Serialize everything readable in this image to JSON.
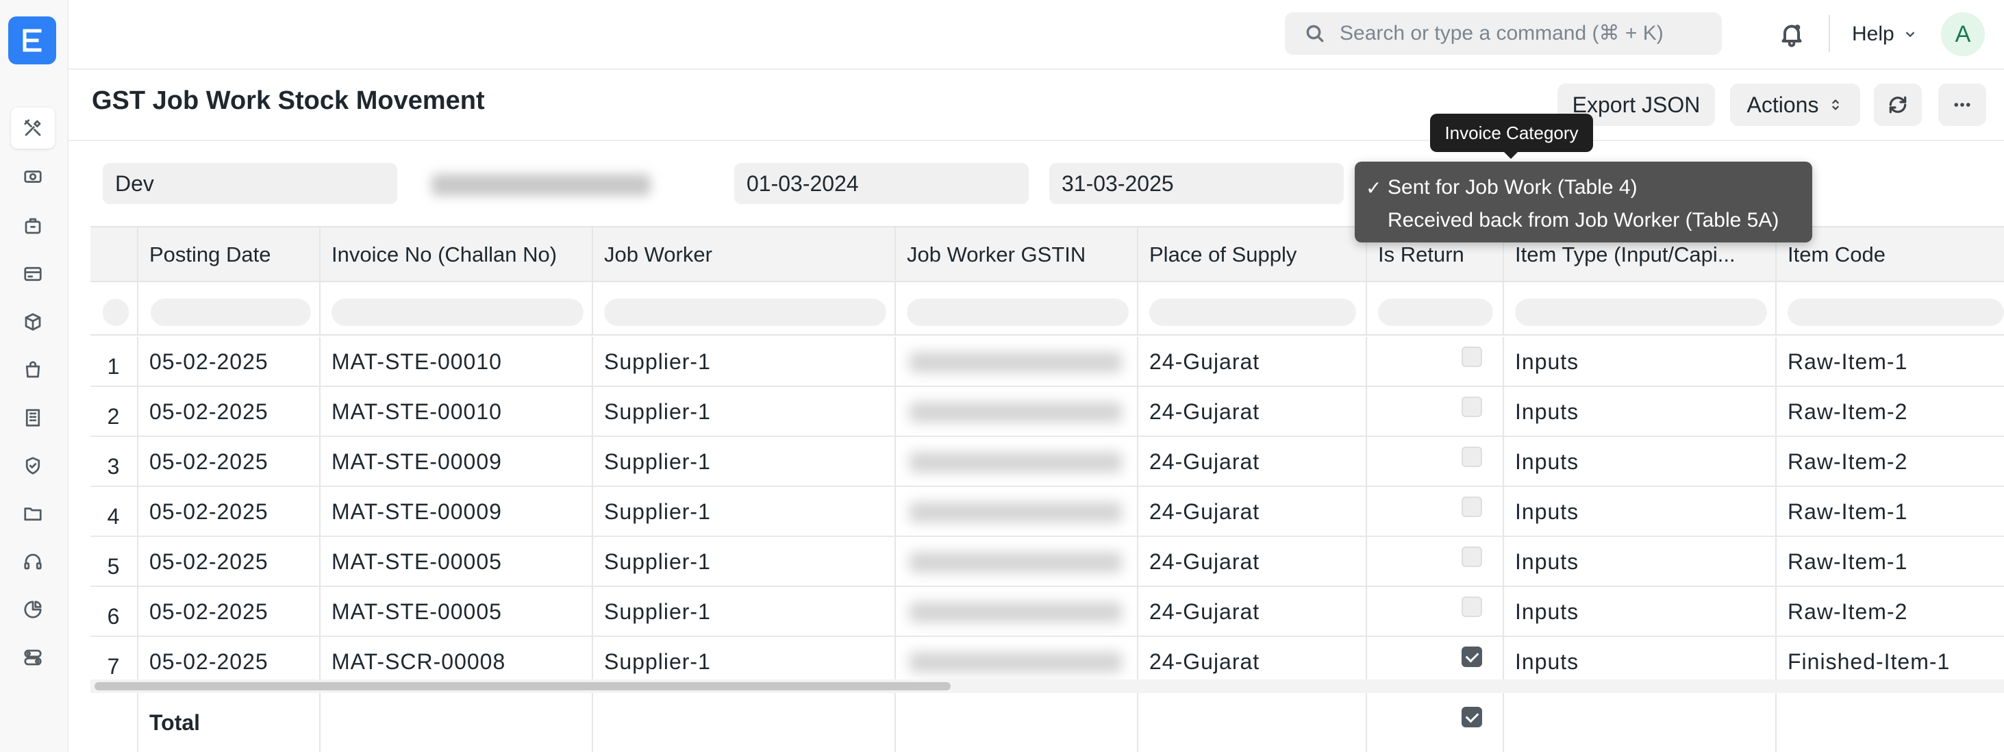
{
  "sidebar": {
    "logo_letter": "E",
    "icons": [
      "tools-icon",
      "money-icon",
      "briefcase-icon",
      "card-icon",
      "box-icon",
      "shopping-bag-icon",
      "building-icon",
      "shield-icon",
      "folder-icon",
      "headset-icon",
      "pie-chart-icon",
      "toggles-icon"
    ]
  },
  "navbar": {
    "search_placeholder": "Search or type a command (⌘ + K)",
    "help_label": "Help",
    "avatar_letter": "A"
  },
  "page": {
    "title": "GST Job Work Stock Movement",
    "export_label": "Export JSON",
    "actions_label": "Actions"
  },
  "filters": {
    "company": "Dev",
    "from_date": "01-03-2024",
    "to_date": "31-03-2025"
  },
  "tooltip": "Invoice Category",
  "dropdown": {
    "options": [
      {
        "label": "Sent for Job Work (Table 4)",
        "selected": true
      },
      {
        "label": "Received back from Job Worker (Table 5A)",
        "selected": false
      }
    ],
    "check_mark": "✓"
  },
  "table": {
    "columns": [
      "",
      "Posting Date",
      "Invoice No (Challan No)",
      "Job Worker",
      "Job Worker GSTIN",
      "Place of Supply",
      "Is Return",
      "Item Type (Input/Capi...",
      "Item Code"
    ],
    "rows": [
      {
        "idx": "1",
        "posting_date": "05-02-2025",
        "invoice_no": "MAT-STE-00010",
        "job_worker": "Supplier-1",
        "place": "24-Gujarat",
        "is_return": false,
        "item_type": "Inputs",
        "item_code": "Raw-Item-1"
      },
      {
        "idx": "2",
        "posting_date": "05-02-2025",
        "invoice_no": "MAT-STE-00010",
        "job_worker": "Supplier-1",
        "place": "24-Gujarat",
        "is_return": false,
        "item_type": "Inputs",
        "item_code": "Raw-Item-2"
      },
      {
        "idx": "3",
        "posting_date": "05-02-2025",
        "invoice_no": "MAT-STE-00009",
        "job_worker": "Supplier-1",
        "place": "24-Gujarat",
        "is_return": false,
        "item_type": "Inputs",
        "item_code": "Raw-Item-2"
      },
      {
        "idx": "4",
        "posting_date": "05-02-2025",
        "invoice_no": "MAT-STE-00009",
        "job_worker": "Supplier-1",
        "place": "24-Gujarat",
        "is_return": false,
        "item_type": "Inputs",
        "item_code": "Raw-Item-1"
      },
      {
        "idx": "5",
        "posting_date": "05-02-2025",
        "invoice_no": "MAT-STE-00005",
        "job_worker": "Supplier-1",
        "place": "24-Gujarat",
        "is_return": false,
        "item_type": "Inputs",
        "item_code": "Raw-Item-1"
      },
      {
        "idx": "6",
        "posting_date": "05-02-2025",
        "invoice_no": "MAT-STE-00005",
        "job_worker": "Supplier-1",
        "place": "24-Gujarat",
        "is_return": false,
        "item_type": "Inputs",
        "item_code": "Raw-Item-2"
      },
      {
        "idx": "7",
        "posting_date": "05-02-2025",
        "invoice_no": "MAT-SCR-00008",
        "job_worker": "Supplier-1",
        "place": "24-Gujarat",
        "is_return": true,
        "item_type": "Inputs",
        "item_code": "Finished-Item-1"
      }
    ],
    "total_label": "Total",
    "total_is_return": true
  }
}
